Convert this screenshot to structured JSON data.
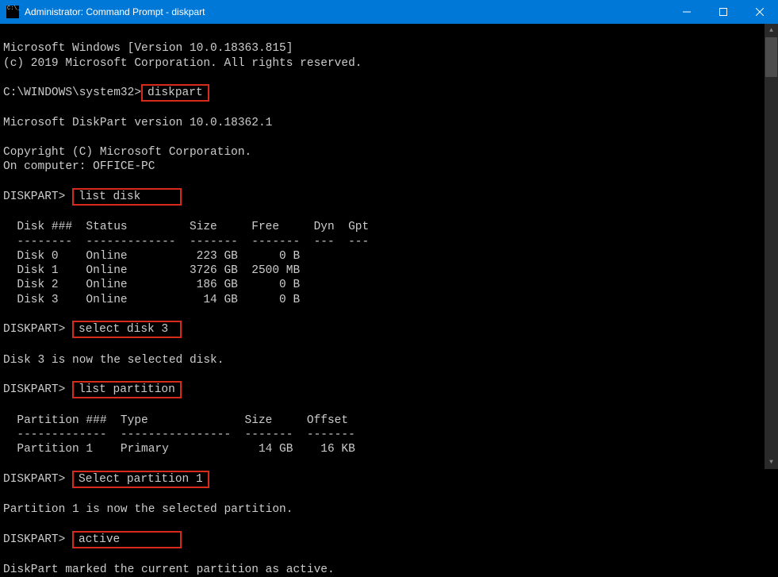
{
  "titlebar": {
    "title": "Administrator: Command Prompt - diskpart"
  },
  "content": {
    "version_line": "Microsoft Windows [Version 10.0.18363.815]",
    "copyright_line": "(c) 2019 Microsoft Corporation. All rights reserved.",
    "initial_prompt": "C:\\WINDOWS\\system32>",
    "cmd_diskpart": "diskpart",
    "diskpart_version": "Microsoft DiskPart version 10.0.18362.1",
    "diskpart_copyright": "Copyright (C) Microsoft Corporation.",
    "on_computer": "On computer: OFFICE-PC",
    "diskpart_prompt": "DISKPART> ",
    "cmd_list_disk": "list disk     ",
    "disk_header": "  Disk ###  Status         Size     Free     Dyn  Gpt",
    "disk_separator": "  --------  -------------  -------  -------  ---  ---",
    "disks": [
      "  Disk 0    Online          223 GB      0 B",
      "  Disk 1    Online         3726 GB  2500 MB",
      "  Disk 2    Online          186 GB      0 B",
      "  Disk 3    Online           14 GB      0 B"
    ],
    "cmd_select_disk": "select disk 3 ",
    "select_disk_result": "Disk 3 is now the selected disk.",
    "cmd_list_partition": "list partition",
    "part_header": "  Partition ###  Type              Size     Offset",
    "part_separator": "  -------------  ----------------  -------  -------",
    "partitions": [
      "  Partition 1    Primary             14 GB    16 KB"
    ],
    "cmd_select_partition": "Select partition 1",
    "select_part_result": "Partition 1 is now the selected partition.",
    "cmd_active": "active        ",
    "active_result": "DiskPart marked the current partition as active."
  }
}
